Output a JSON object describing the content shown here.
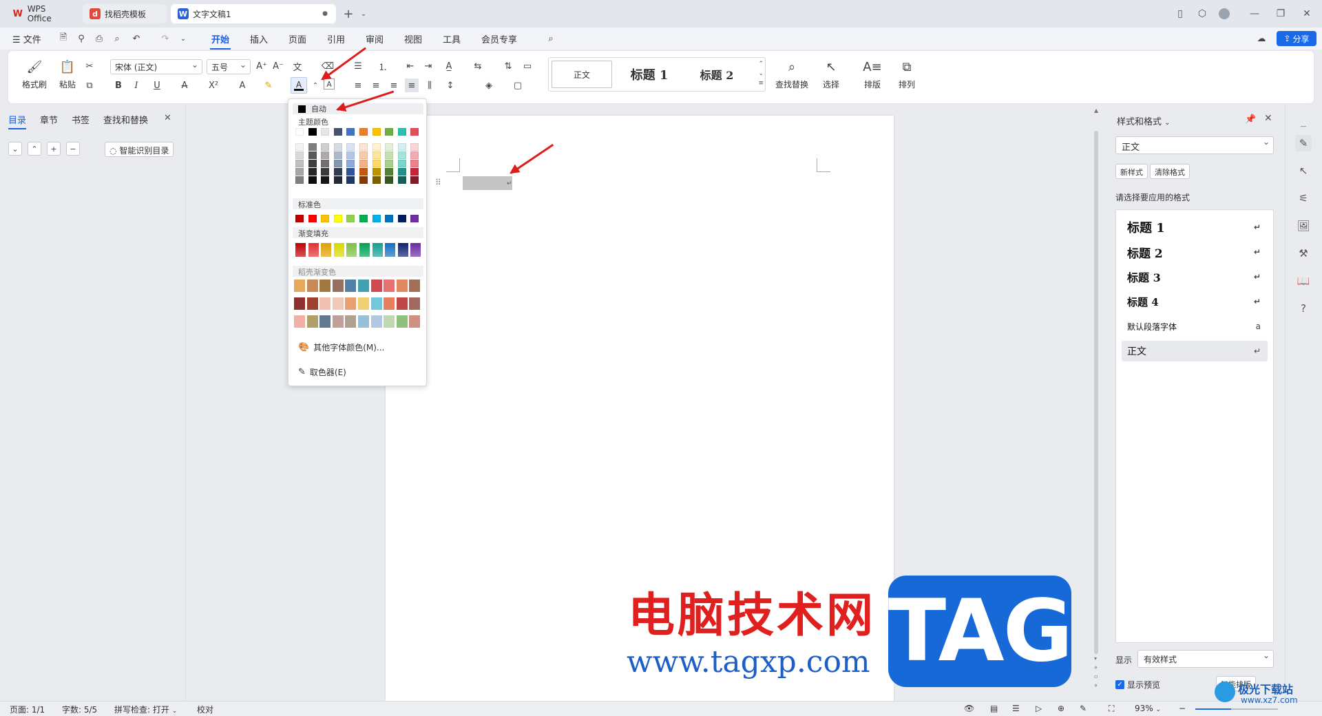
{
  "window": {
    "tabs": [
      {
        "label": "WPS Office",
        "logo": "W",
        "logo_color": "#d9241c"
      },
      {
        "label": "找稻壳模板",
        "logo": "◐",
        "logo_color": "#e04a3a"
      },
      {
        "label": "文字文稿1",
        "logo": "W",
        "logo_color": "#2b61e0"
      }
    ],
    "share_label": "分享"
  },
  "menubar": {
    "file_label": "文件",
    "items": [
      "开始",
      "插入",
      "页面",
      "引用",
      "审阅",
      "视图",
      "工具",
      "会员专享"
    ],
    "active": "开始"
  },
  "ribbon": {
    "format_painter": "格式刷",
    "paste": "粘贴",
    "font_name": "宋体 (正文)",
    "font_size": "五号",
    "styles": [
      "正文",
      "标题 1",
      "标题 2"
    ],
    "find_replace": "查找替换",
    "select": "选择",
    "layout": "排版",
    "arrange": "排列"
  },
  "left_panel": {
    "tabs": [
      "目录",
      "章节",
      "书签",
      "查找和替换"
    ],
    "smart_toc": "智能识别目录"
  },
  "color_popup": {
    "auto_label": "自动",
    "theme_label": "主题颜色",
    "standard_label": "标准色",
    "gradient_label": "渐变填充",
    "daoke_label": "稻壳渐变色",
    "more_colors": "其他字体颜色(M)...",
    "picker": "取色器(E)",
    "theme_top": [
      "#ffffff",
      "#000000",
      "#e7e6e6",
      "#44546a",
      "#4472c4",
      "#ed7d31",
      "#ffc000",
      "#70ad47",
      "#2fbfae",
      "#e84c5c"
    ],
    "theme_shades": [
      [
        "#f2f2f2",
        "#7f7f7f",
        "#d0cece",
        "#d6dce4",
        "#d9e2f3",
        "#fbe5d5",
        "#fff2cc",
        "#e2efd9",
        "#d2f1ee",
        "#f9d4d8"
      ],
      [
        "#d9d9d9",
        "#595959",
        "#aeaaaa",
        "#adb9ca",
        "#b4c6e7",
        "#f7caac",
        "#fee599",
        "#c5e0b3",
        "#a5e3dd",
        "#f3aab2"
      ],
      [
        "#bfbfbf",
        "#404040",
        "#757070",
        "#8496b0",
        "#8eaadb",
        "#f4b083",
        "#ffd965",
        "#a8d08d",
        "#78d6cc",
        "#ed808c"
      ],
      [
        "#a6a6a6",
        "#262626",
        "#3a3838",
        "#323e4f",
        "#2f5496",
        "#c45911",
        "#bf9000",
        "#538135",
        "#22908a",
        "#c22538"
      ],
      [
        "#7f7f7f",
        "#0d0d0d",
        "#171616",
        "#222a35",
        "#1f3763",
        "#823b0b",
        "#7f6000",
        "#375623",
        "#176059",
        "#811926"
      ]
    ],
    "standard": [
      "#c00000",
      "#ff0000",
      "#ffc000",
      "#ffff00",
      "#92d050",
      "#00b050",
      "#00b0f0",
      "#0070c0",
      "#002060",
      "#7030a0"
    ],
    "gradient": [
      "#c00000",
      "#e03030",
      "#e0a000",
      "#d8d800",
      "#7cc040",
      "#00a050",
      "#10a090",
      "#1070c0",
      "#102070",
      "#6a2aa0"
    ],
    "daoke": [
      [
        "#e8a85c",
        "#c88a58",
        "#a07840",
        "#987060",
        "#5080a8",
        "#40a0b0",
        "#d04850",
        "#e87070",
        "#e08860",
        "#a07058"
      ],
      [
        "#903030",
        "#a04030",
        "#f0c0b0",
        "#f0c8b8",
        "#e8a070",
        "#f0d070",
        "#70c8d8",
        "#e88060",
        "#c04848",
        "#a06860"
      ],
      [
        "#f0b0a8",
        "#b0a068",
        "#607890",
        "#c0a098",
        "#b0a090",
        "#98c0d8",
        "#b0c8e0",
        "#c0d8b0",
        "#90c080",
        "#d09080"
      ]
    ]
  },
  "right_panel": {
    "title": "样式和格式",
    "current_style": "正文",
    "new_style": "新样式",
    "clear_format": "清除格式",
    "prompt": "请选择要应用的格式",
    "styles": [
      {
        "label": "标题  1",
        "size": 18,
        "bold": true,
        "mark": "↵"
      },
      {
        "label": "标题  2",
        "size": 17,
        "bold": true,
        "mark": "↵"
      },
      {
        "label": "标题  3",
        "size": 16,
        "bold": true,
        "mark": "↵"
      },
      {
        "label": "标题 4",
        "size": 15,
        "bold": true,
        "mark": "↵"
      },
      {
        "label": "默认段落字体",
        "size": 12,
        "bold": false,
        "mark": "a"
      },
      {
        "label": "正文",
        "size": 14,
        "bold": false,
        "mark": "↵"
      }
    ],
    "show_label": "显示",
    "show_value": "有效样式",
    "preview_label": "显示预览",
    "smart_layout": "智能排版"
  },
  "statusbar": {
    "page": "页面: 1/1",
    "words": "字数: 5/5",
    "spell": "拼写检查: 打开",
    "proof": "校对",
    "zoom": "93%"
  },
  "watermark": {
    "title": "电脑技术网",
    "url": "www.tagxp.com",
    "tag": "TAG",
    "site": "极光下载站",
    "site_url": "www.xz7.com"
  }
}
